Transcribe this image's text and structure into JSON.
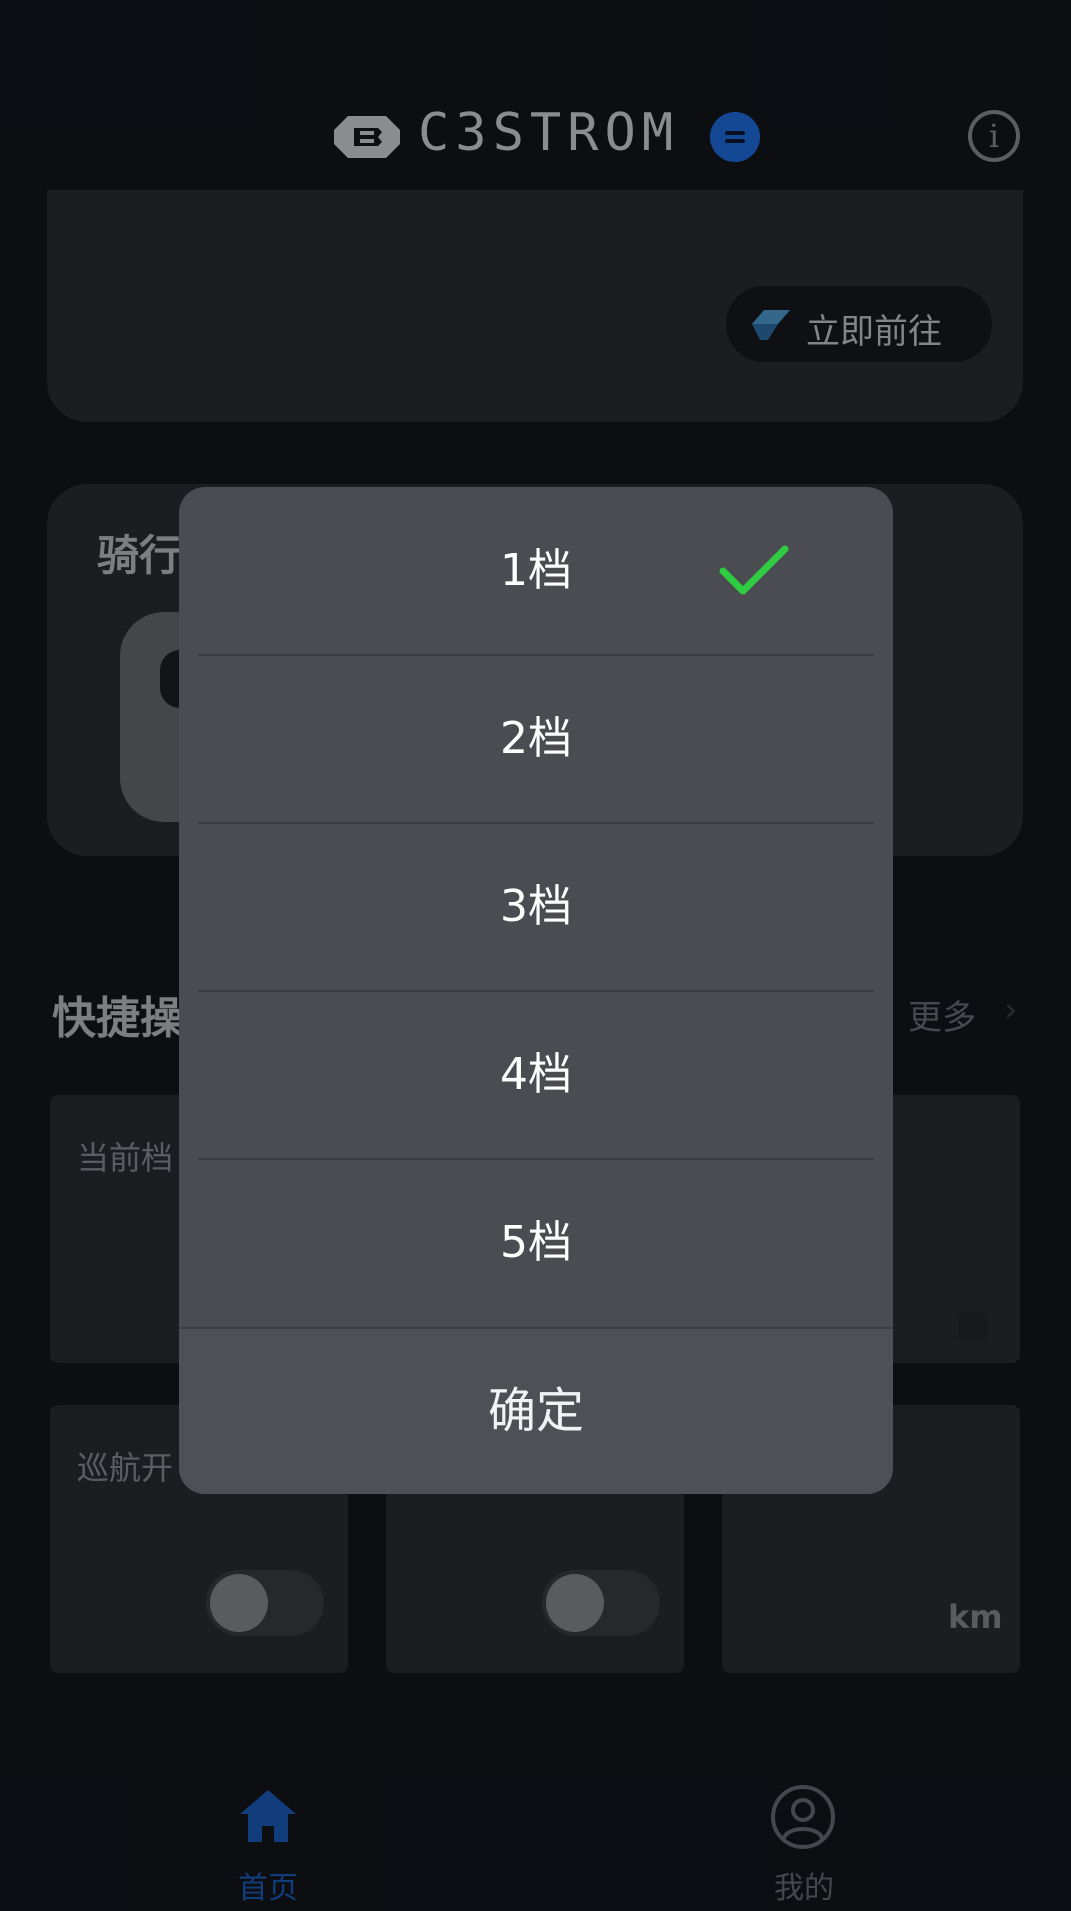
{
  "header": {
    "brand": "C3STROM",
    "info_glyph": "i",
    "icons": [
      "brand-logo-icon",
      "model-badge-icon",
      "info-icon"
    ]
  },
  "banner": {
    "subtitle": "",
    "goto_label": "立即前往"
  },
  "ride_card": {
    "title": "骑行"
  },
  "quick_ops": {
    "title": "快捷操",
    "more_label": "更多",
    "more_chevron": "›",
    "cards": [
      {
        "label": "当前档"
      },
      {
        "label": "巡航开"
      }
    ],
    "unit": "km"
  },
  "gear_dialog": {
    "options": [
      "1档",
      "2档",
      "3档",
      "4档",
      "5档"
    ],
    "selected_index": 0,
    "confirm_label": "确定",
    "check_color": "#2ecc40"
  },
  "nav": {
    "items": [
      {
        "label": "首页",
        "icon": "home-icon",
        "active": true
      },
      {
        "label": "我的",
        "icon": "user-icon",
        "active": false
      }
    ],
    "active_color": "#1d5fbf"
  }
}
